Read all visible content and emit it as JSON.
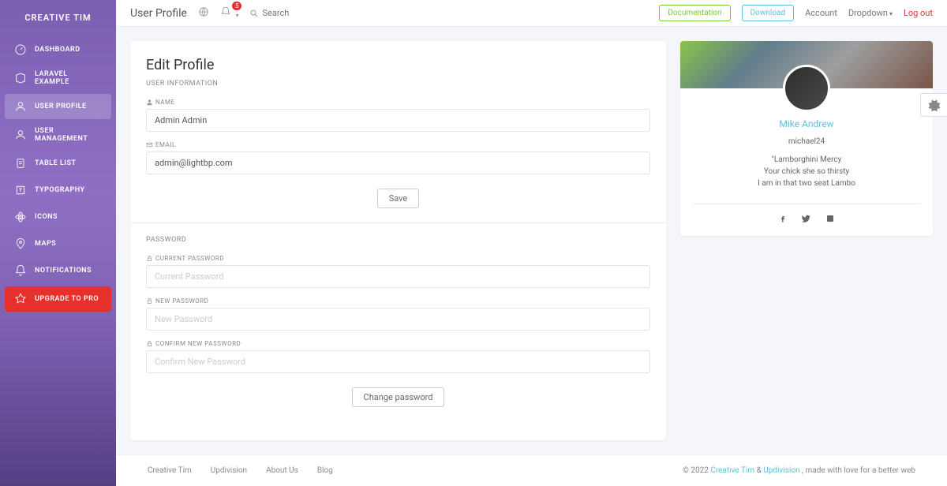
{
  "brand": "CREATIVE TIM",
  "sidebar": {
    "items": [
      {
        "label": "DASHBOARD"
      },
      {
        "label": "LARAVEL EXAMPLE"
      },
      {
        "label": "USER PROFILE"
      },
      {
        "label": "USER MANAGEMENT"
      },
      {
        "label": "TABLE LIST"
      },
      {
        "label": "TYPOGRAPHY"
      },
      {
        "label": "ICONS"
      },
      {
        "label": "MAPS"
      },
      {
        "label": "NOTIFICATIONS"
      },
      {
        "label": "UPGRADE TO PRO"
      }
    ]
  },
  "topbar": {
    "page_title": "User Profile",
    "notif_count": "5",
    "search_placeholder": "Search",
    "documentation": "Documentation",
    "download": "Download",
    "account": "Account",
    "dropdown": "Dropdown",
    "logout": "Log out"
  },
  "edit": {
    "title": "Edit Profile",
    "section_user": "USER INFORMATION",
    "name_label": "NAME",
    "name_value": "Admin Admin",
    "email_label": "EMAIL",
    "email_value": "admin@lightbp.com",
    "save": "Save",
    "section_pw": "PASSWORD",
    "cur_pw_label": "CURRENT PASSWORD",
    "cur_pw_ph": "Current Password",
    "new_pw_label": "NEW PASSWORD",
    "new_pw_ph": "New Password",
    "conf_pw_label": "CONFIRM NEW PASSWORD",
    "conf_pw_ph": "Confirm New Password",
    "change_pw": "Change password"
  },
  "profile": {
    "name": "Mike Andrew",
    "username": "michael24",
    "quote_l1": "\"Lamborghini Mercy",
    "quote_l2": "Your chick she so thirsty",
    "quote_l3": "I am in that two seat Lambo"
  },
  "footer": {
    "links": [
      "Creative Tim",
      "Updivision",
      "About Us",
      "Blog"
    ],
    "copyright_prefix": "© 2022 ",
    "ct": "Creative Tim",
    "amp": " & ",
    "upd": "Updivision",
    "suffix": " , made with love for a better web"
  }
}
